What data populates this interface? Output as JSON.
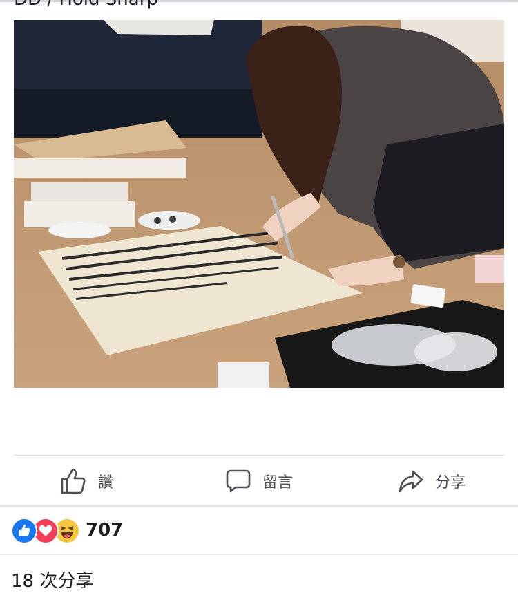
{
  "post": {
    "caption_cut": "DD / Hold Sharp"
  },
  "actions": {
    "like_label": "讚",
    "comment_label": "留言",
    "share_label": "分享"
  },
  "reactions": {
    "icons": [
      "like-icon",
      "love-icon",
      "haha-icon"
    ],
    "count": "707"
  },
  "shares": {
    "text": "18 次分享"
  },
  "colors": {
    "like_blue": "#1877f2",
    "love_red": "#f33e58",
    "haha_yellow": "#f7c53e",
    "action_gray": "#4b4f56"
  }
}
